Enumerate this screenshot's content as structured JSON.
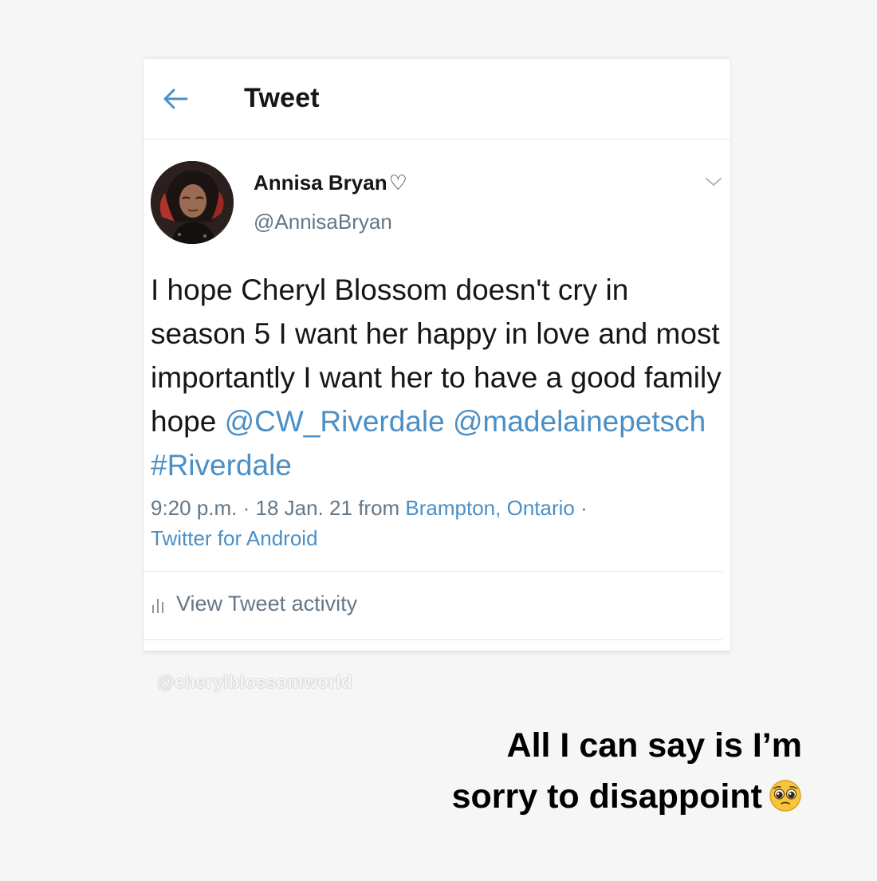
{
  "header": {
    "title": "Tweet",
    "back_icon": "back-arrow-icon"
  },
  "tweet": {
    "author_name": "Annisa Bryan",
    "author_name_suffix": "♡",
    "author_handle": "@AnnisaBryan",
    "text_part1": "I hope Cheryl Blossom doesn't cry in season 5 I want her happy in love and most importantly I want her to have a good family hope ",
    "mention1": "@CW_Riverdale",
    "mention2": "@madelainepetsch",
    "hashtag": "#Riverdale",
    "time": "9:20 p.m.",
    "date": "18 Jan. 21",
    "from_label": "from",
    "location": "Brampton, Ontario",
    "source": "Twitter for Android",
    "activity_label": "View Tweet activity",
    "activity_icon": "bar-chart-icon",
    "menu_icon": "chevron-down-icon"
  },
  "watermark": "@cherylblossomworld",
  "caption": {
    "line1": "All I can say is I’m",
    "line2": "sorry to disappoint",
    "emoji_icon": "pleading-face-emoji"
  },
  "colors": {
    "link": "#4a8fc6",
    "secondary_text": "#657786",
    "background": "#f6f6f6",
    "card": "#ffffff"
  }
}
